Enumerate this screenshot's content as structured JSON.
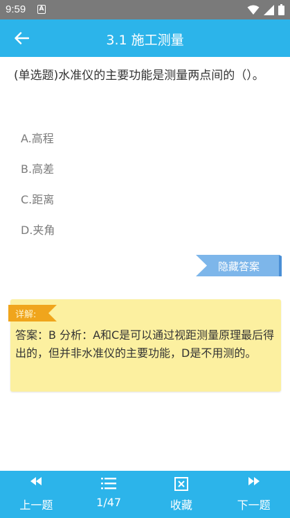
{
  "status_bar": {
    "time": "9:59",
    "notification_letter": "A"
  },
  "app_bar": {
    "title": "3.1 施工测量"
  },
  "question": {
    "text": "(单选题)水准仪的主要功能是测量两点间的（）。",
    "options": [
      {
        "label": "A.高程"
      },
      {
        "label": "B.高差"
      },
      {
        "label": "C.距离"
      },
      {
        "label": "D.夹角"
      }
    ]
  },
  "answer_toggle": {
    "label": "隐藏答案",
    "color": "#7db6ea"
  },
  "explanation": {
    "tag": "详解:",
    "text": "答案：B 分析：A和C是可以通过视距测量原理最后得出的，但并非水准仪的主要功能，D是不用测的。",
    "background": "#fcf0a0",
    "tag_color": "#f0a51c"
  },
  "bottom_nav": {
    "prev_label": "上一题",
    "progress": "1/47",
    "favorite_label": "收藏",
    "next_label": "下一题"
  },
  "colors": {
    "primary": "#2cb4ea",
    "status_bar": "#7a7a7a"
  }
}
